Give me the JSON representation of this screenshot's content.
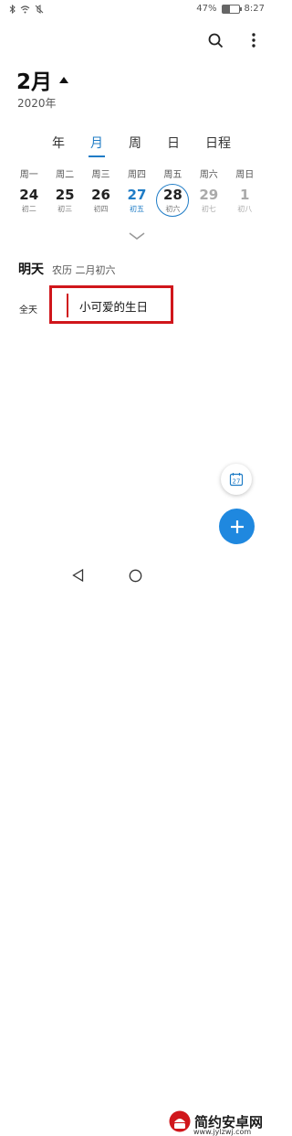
{
  "status_bar": {
    "battery": "47%",
    "time": "8:27",
    "battery_level": 0.47
  },
  "header": {
    "month": "2月",
    "year": "2020年"
  },
  "view_tabs": [
    "年",
    "月",
    "周",
    "日",
    "日程"
  ],
  "active_tab": "月",
  "week_days": [
    "周一",
    "周二",
    "周三",
    "周四",
    "周五",
    "周六",
    "周日"
  ],
  "dates": [
    {
      "day": "24",
      "lunar": "初二"
    },
    {
      "day": "25",
      "lunar": "初三"
    },
    {
      "day": "26",
      "lunar": "初四"
    },
    {
      "day": "27",
      "lunar": "初五"
    },
    {
      "day": "28",
      "lunar": "初六"
    },
    {
      "day": "29",
      "lunar": "初七"
    },
    {
      "day": "1",
      "lunar": "初八"
    }
  ],
  "day_section": {
    "title": "明天",
    "lunar": "农历 二月初六"
  },
  "allday_label": "全天",
  "event": {
    "title": "小可爱的生日",
    "color": "#d0161b"
  },
  "fab_calendar_day": "27",
  "accent_color": "#1f7cc6",
  "watermark": {
    "text": "简约安卓网",
    "url": "www.jylzwj.com"
  }
}
